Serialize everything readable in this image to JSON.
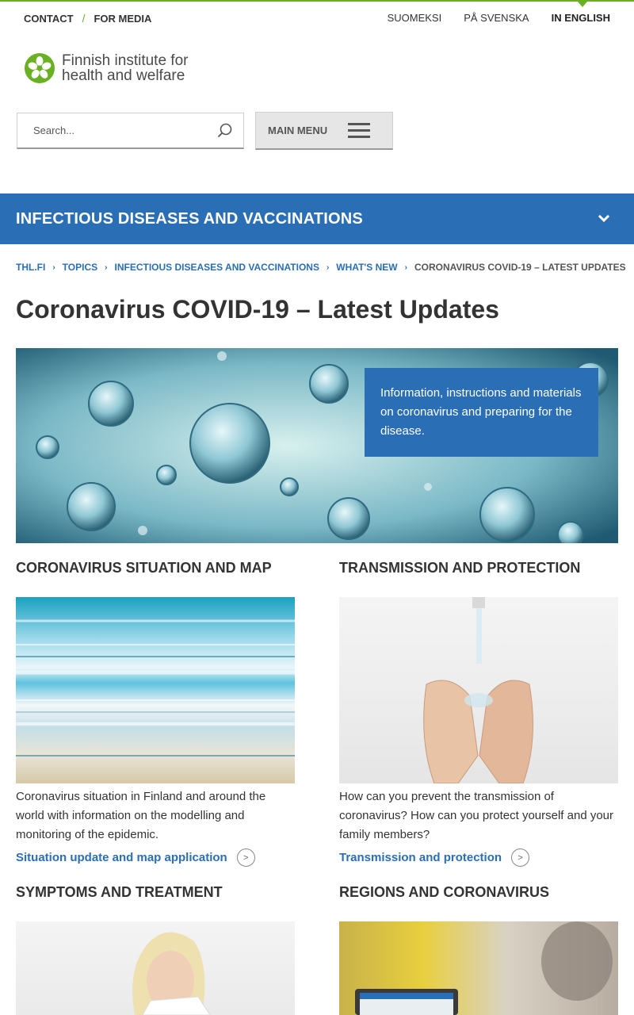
{
  "top_links": {
    "contact": "CONTACT",
    "separator": "/",
    "media": "FOR MEDIA"
  },
  "languages": [
    {
      "label": "SUOMEKSI",
      "active": false
    },
    {
      "label": "PÅ SVENSKA",
      "active": false
    },
    {
      "label": "IN ENGLISH",
      "active": true
    }
  ],
  "logo": {
    "line1": "Finnish institute for",
    "line2": "health and welfare",
    "icon": "flower-logo-icon"
  },
  "search": {
    "placeholder": "Search...",
    "icon": "search-icon"
  },
  "main_menu": {
    "label": "MAIN MENU",
    "icon": "hamburger-icon"
  },
  "section": {
    "title": "INFECTIOUS DISEASES AND VACCINATIONS",
    "icon": "chevron-down-icon"
  },
  "breadcrumb": [
    "THL.FI",
    "TOPICS",
    "INFECTIOUS DISEASES AND VACCINATIONS",
    "WHAT'S NEW",
    "CORONAVIRUS COVID-19 – LATEST UPDATES"
  ],
  "page_title": "Coronavirus COVID-19 – Latest Updates",
  "hero": {
    "caption": "Information, instructions and materials on coronavirus and preparing for the disease."
  },
  "cards": [
    {
      "title": "CORONAVIRUS SITUATION AND MAP",
      "text": "Coronavirus situation in Finland and around the world with information on the modelling and monitoring of the epidemic.",
      "link": "Situation update and map application"
    },
    {
      "title": "TRANSMISSION AND PROTECTION",
      "text": "How can you prevent the transmission of coronavirus? How can you protect yourself and your family members?",
      "link": "Transmission and protection"
    },
    {
      "title": "SYMPTOMS AND TREATMENT"
    },
    {
      "title": "REGIONS AND CORONAVIRUS"
    }
  ],
  "colors": {
    "accent_blue": "#2a6eb5",
    "brand_green": "#6ab023"
  }
}
